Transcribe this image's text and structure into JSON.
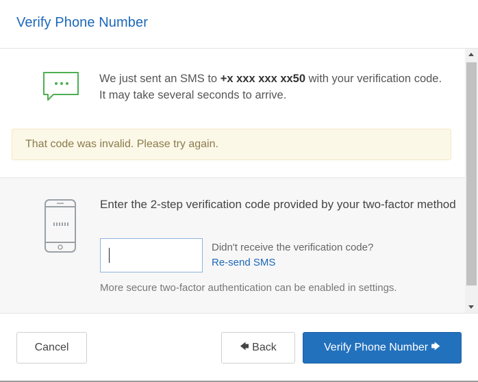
{
  "dialog": {
    "title": "Verify Phone Number"
  },
  "sms_notice": {
    "prefix": "We just sent an SMS to ",
    "phone": "+x xxx xxx xx50",
    "suffix": " with your verification code. It may take several seconds to arrive.",
    "icon": "chat-bubble-icon",
    "icon_color": "#4caf50"
  },
  "alert": {
    "message": "That code was invalid. Please try again."
  },
  "code_entry": {
    "prompt": "Enter the 2-step verification code provided by your two-factor method",
    "input_value": "",
    "icon": "phone-icon",
    "resend_question": "Didn't receive the verification code?",
    "resend_link": "Re-send SMS",
    "secure_note": "More secure two-factor authentication can be enabled in settings."
  },
  "footer": {
    "cancel_label": "Cancel",
    "back_label": "Back",
    "back_icon": "arrow-left-icon",
    "verify_label": "Verify Phone Number",
    "verify_icon": "arrow-right-icon"
  },
  "colors": {
    "accent": "#1b67b8",
    "primary_button": "#2271bd",
    "alert_bg": "#fcf8e8",
    "alert_text": "#8a7a4b"
  }
}
